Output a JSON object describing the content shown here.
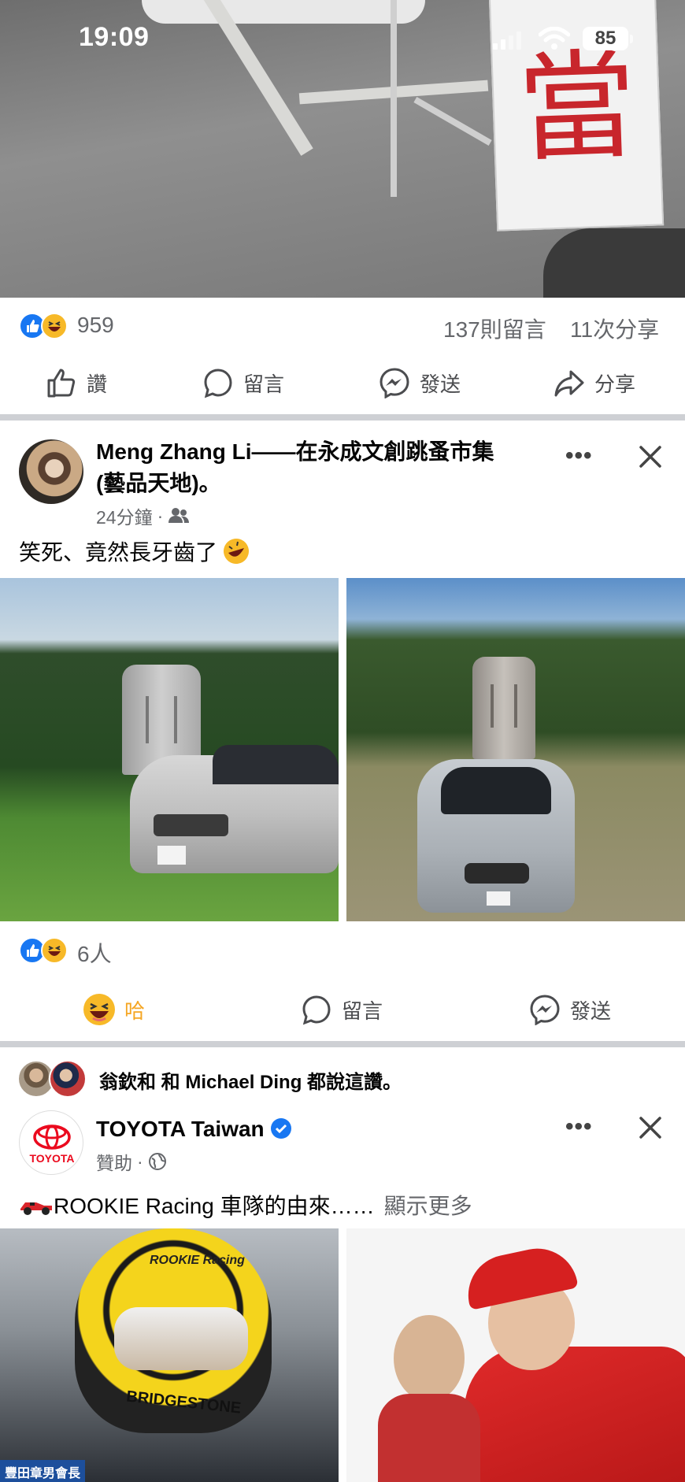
{
  "status_bar": {
    "time": "19:09",
    "battery": "85"
  },
  "top_post": {
    "reactions_count": "959",
    "comments_count": "137則留言",
    "shares_count": "11次分享",
    "actions": {
      "like": "讚",
      "comment": "留言",
      "send": "發送",
      "share": "分享"
    }
  },
  "post_meng": {
    "author_line1": "Meng Zhang Li——在永成文創跳蚤市集",
    "author_line2": "(藝品天地)。",
    "time": "24分鐘",
    "text": "笑死、竟然長牙齒了",
    "reactions_count": "6人",
    "actions": {
      "haha": "哈",
      "comment": "留言",
      "send": "發送"
    }
  },
  "post_toyota": {
    "liked_by": "翁欽和 和 Michael Ding 都說這讚。",
    "author": "TOYOTA Taiwan",
    "sponsored": "贊助",
    "text": "ROOKIE Racing 車隊的由來……",
    "see_more": "顯示更多",
    "logo_text": "TOYOTA",
    "photo_caption": "豐田章男會長",
    "helmet_text1": "ROOKIE Racing",
    "helmet_text2": "BRIDGESTONE"
  },
  "colors": {
    "accent_blue": "#1877f2",
    "haha_yellow": "#f7b928",
    "toyota_red": "#eb0a1e"
  }
}
